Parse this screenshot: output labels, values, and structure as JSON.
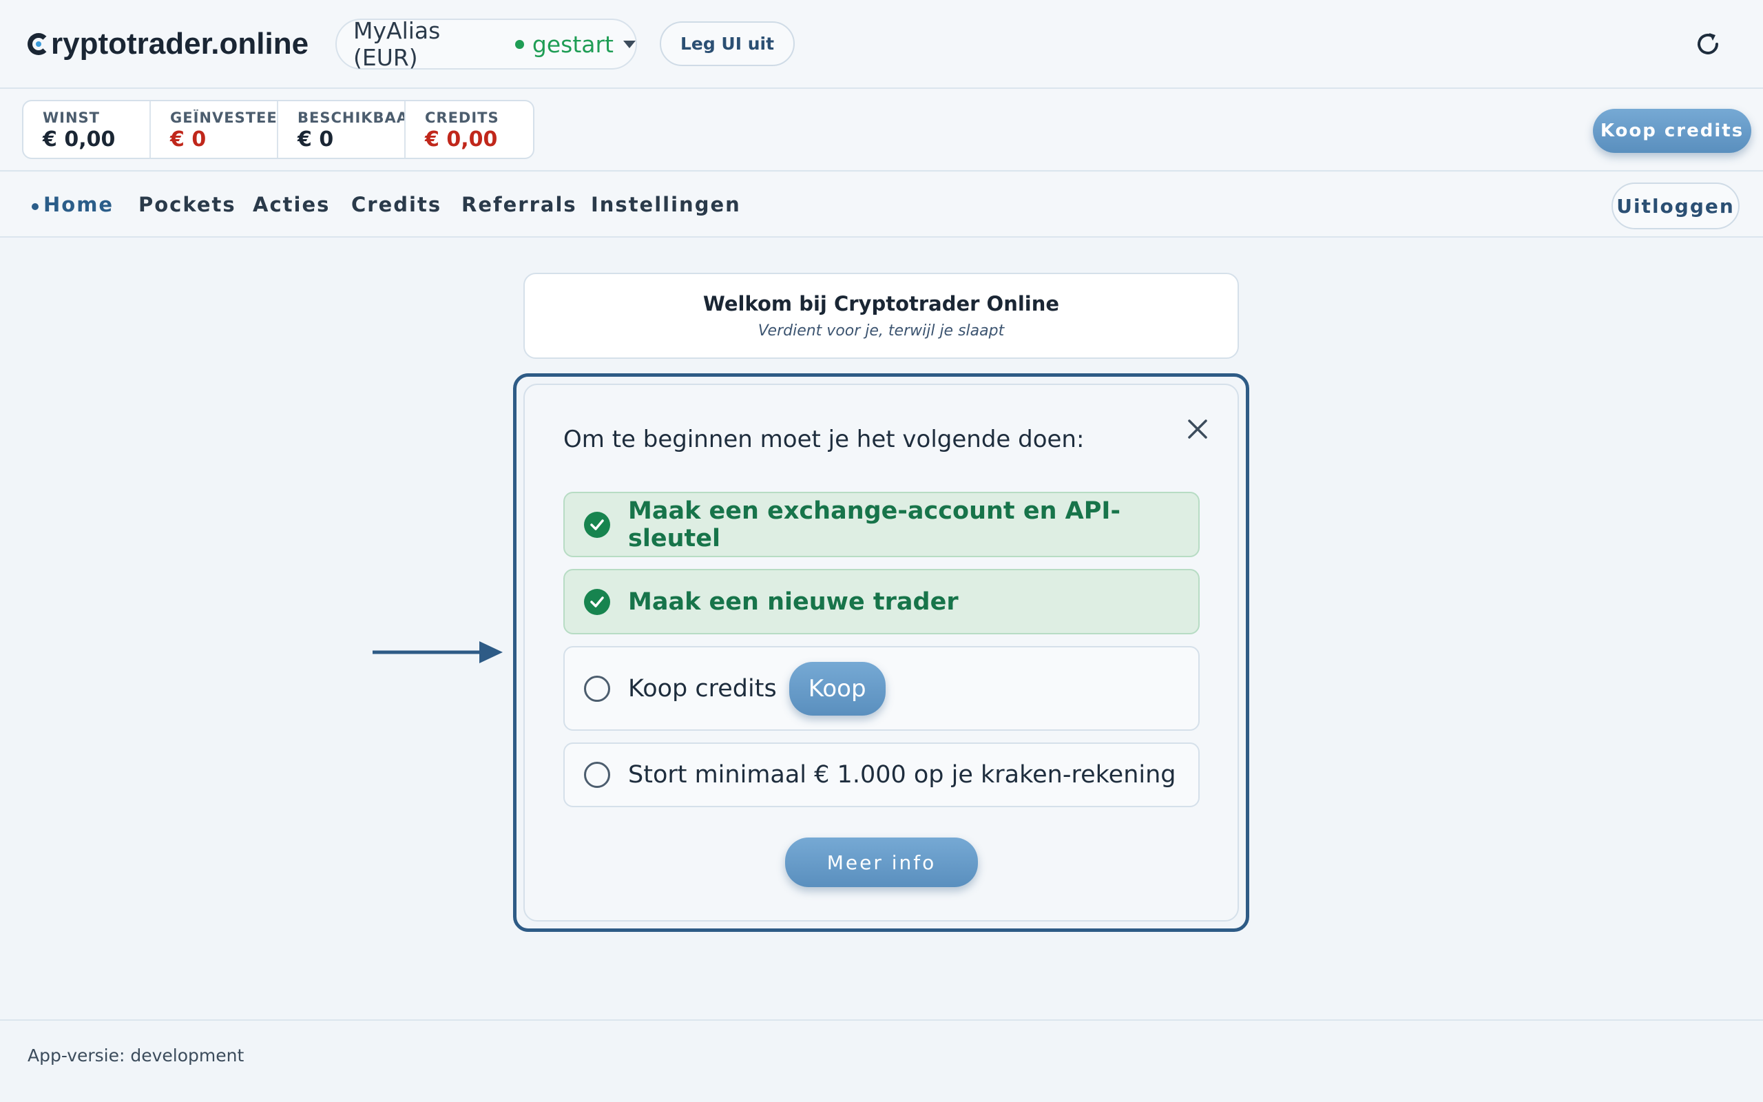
{
  "header": {
    "logo_text": "ryptotrader.online",
    "account_alias": "MyAlias (EUR)",
    "account_status": "gestart",
    "leg_ui_label": "Leg UI uit"
  },
  "stats": [
    {
      "label": "WINST",
      "value": "€ 0,00",
      "negative": false
    },
    {
      "label": "GEÏNVESTEERD",
      "value": "€ 0",
      "negative": true
    },
    {
      "label": "BESCHIKBAAR",
      "value": "€ 0",
      "negative": false
    },
    {
      "label": "CREDITS",
      "value": "€ 0,00",
      "negative": true
    }
  ],
  "koop_credits_label": "Koop credits",
  "nav": {
    "items": [
      "Home",
      "Pockets",
      "Acties",
      "Credits",
      "Referrals",
      "Instellingen"
    ],
    "active": "Home",
    "logout_label": "Uitloggen"
  },
  "welcome": {
    "title": "Welkom bij Cryptotrader Online",
    "subtitle": "Verdient voor je, terwijl je slaapt"
  },
  "onboarding": {
    "title": "Om te beginnen moet je het volgende doen:",
    "tasks": [
      {
        "label": "Maak een exchange-account en API-sleutel",
        "done": true
      },
      {
        "label": "Maak een nieuwe trader",
        "done": true
      },
      {
        "label": "Koop credits",
        "done": false,
        "action_label": "Koop"
      },
      {
        "label": "Stort minimaal € 1.000 op je kraken-rekening",
        "done": false
      }
    ],
    "more_info_label": "Meer info"
  },
  "footer": {
    "version_text": "App-versie: development"
  },
  "colors": {
    "accent": "#2b5d89",
    "success": "#17844f",
    "negative": "#c0271b"
  }
}
